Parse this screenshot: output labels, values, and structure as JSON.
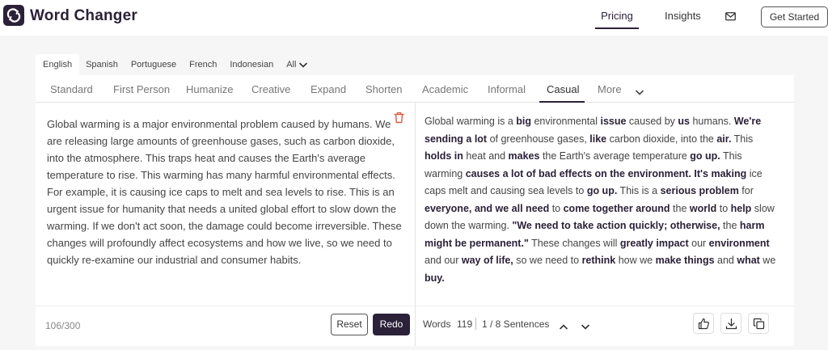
{
  "header": {
    "logo_text": "Word Changer",
    "nav": {
      "pricing": "Pricing",
      "insights": "Insights"
    },
    "get_started": "Get Started",
    "icons": [
      "word-changer-logo-icon",
      "mail-icon"
    ]
  },
  "languages": {
    "items": [
      "English",
      "Spanish",
      "Portuguese",
      "French",
      "Indonesian"
    ],
    "all_label": "All",
    "selected": "English"
  },
  "modes": {
    "items": [
      "Standard",
      "First Person",
      "Humanize",
      "Creative",
      "Expand",
      "Shorten",
      "Academic",
      "Informal",
      "Casual"
    ],
    "more_label": "More",
    "selected": "Casual"
  },
  "input": {
    "text": "Global warming is a major environmental problem caused by humans. We are releasing large amounts of greenhouse gases, such as carbon dioxide, into the atmosphere. This traps heat and causes the Earth's average temperature to rise. This warming has many harmful environmental effects. For example, it is causing ice caps to melt and sea levels to rise. This is an urgent issue for humanity that needs a united global effort to slow down the warming. If we don't act soon, the damage could become irreversible. These changes will profoundly affect ecosystems and how we live, so we need to quickly re-examine our industrial and consumer habits.",
    "char_count": "106/300",
    "reset_label": "Reset",
    "redo_label": "Redo"
  },
  "output": {
    "segments": [
      {
        "t": "Global warming is a ",
        "b": false
      },
      {
        "t": "big",
        "b": true
      },
      {
        "t": " environmental ",
        "b": false
      },
      {
        "t": "issue",
        "b": true
      },
      {
        "t": " caused by ",
        "b": false
      },
      {
        "t": "us",
        "b": true
      },
      {
        "t": " humans. ",
        "b": false
      },
      {
        "t": "We're sending a lot",
        "b": true
      },
      {
        "t": " of greenhouse gases, ",
        "b": false
      },
      {
        "t": "like",
        "b": true
      },
      {
        "t": " carbon dioxide, into the ",
        "b": false
      },
      {
        "t": "air.",
        "b": true
      },
      {
        "t": " This ",
        "b": false
      },
      {
        "t": "holds in",
        "b": true
      },
      {
        "t": " heat and ",
        "b": false
      },
      {
        "t": "makes",
        "b": true
      },
      {
        "t": " the Earth's average temperature ",
        "b": false
      },
      {
        "t": "go up.",
        "b": true
      },
      {
        "t": " This warming ",
        "b": false
      },
      {
        "t": "causes a lot of bad effects on the environment. It's making",
        "b": true
      },
      {
        "t": " ice caps melt and causing sea levels to ",
        "b": false
      },
      {
        "t": "go up.",
        "b": true
      },
      {
        "t": " This is a ",
        "b": false
      },
      {
        "t": "serious problem",
        "b": true
      },
      {
        "t": " for ",
        "b": false
      },
      {
        "t": "everyone, and we all need",
        "b": true
      },
      {
        "t": " to ",
        "b": false
      },
      {
        "t": "come together around",
        "b": true
      },
      {
        "t": " the ",
        "b": false
      },
      {
        "t": "world",
        "b": true
      },
      {
        "t": " to ",
        "b": false
      },
      {
        "t": "help",
        "b": true
      },
      {
        "t": " slow down the warming. ",
        "b": false
      },
      {
        "t": "\"We need to take action quickly; otherwise,",
        "b": true
      },
      {
        "t": " the ",
        "b": false
      },
      {
        "t": "harm might be permanent.\"",
        "b": true
      },
      {
        "t": " These changes will ",
        "b": false
      },
      {
        "t": "greatly impact",
        "b": true
      },
      {
        "t": " our ",
        "b": false
      },
      {
        "t": "environment",
        "b": true
      },
      {
        "t": " and our ",
        "b": false
      },
      {
        "t": "way of life,",
        "b": true
      },
      {
        "t": " so we need to ",
        "b": false
      },
      {
        "t": "rethink",
        "b": true
      },
      {
        "t": " how we ",
        "b": false
      },
      {
        "t": "make things",
        "b": true
      },
      {
        "t": " and ",
        "b": false
      },
      {
        "t": "what",
        "b": true
      },
      {
        "t": " we ",
        "b": false
      },
      {
        "t": "buy.",
        "b": true
      }
    ],
    "words_label": "Words",
    "words_count": "119",
    "sentences_label": "1 / 8 Sentences",
    "icons": [
      "thumbs-up-icon",
      "download-icon",
      "copy-icon"
    ]
  },
  "colors": {
    "brand": "#2b2138",
    "background": "#f6f6f6",
    "panel": "#ffffff"
  }
}
